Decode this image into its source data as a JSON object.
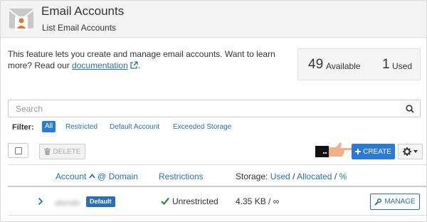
{
  "header": {
    "title": "Email Accounts",
    "subtitle": "List Email Accounts",
    "icon": "envelope-user-icon"
  },
  "intro": {
    "text_before": "This feature lets you create and manage email accounts. Want to learn more? Read our ",
    "link_label": "documentation",
    "text_after": "."
  },
  "stats": {
    "available_count": "49",
    "available_label": "Available",
    "used_count": "1",
    "used_label": "Used"
  },
  "search": {
    "placeholder": "Search"
  },
  "filter": {
    "label": "Filter:",
    "options": [
      "All",
      "Restricted",
      "Default Account",
      "Exceeded Storage"
    ],
    "active": "All"
  },
  "toolbar": {
    "delete_label": "DELETE",
    "create_label": "CREATE"
  },
  "table": {
    "columns": {
      "account": "Account",
      "at_domain": "@ Domain",
      "restrictions": "Restrictions",
      "storage": "Storage:",
      "used": "Used",
      "sep": "/",
      "allocated": "Allocated",
      "percent": "%"
    },
    "rows": [
      {
        "account": "alendo",
        "badge": "Default",
        "restriction": "Unrestricted",
        "storage": "4.35 KB / ∞",
        "manage_label": "MANAGE"
      }
    ]
  },
  "colors": {
    "accent": "#2a7bd6",
    "link": "#2a6fb5",
    "success": "#2e8b3a",
    "icon_orange": "#e8742c"
  }
}
